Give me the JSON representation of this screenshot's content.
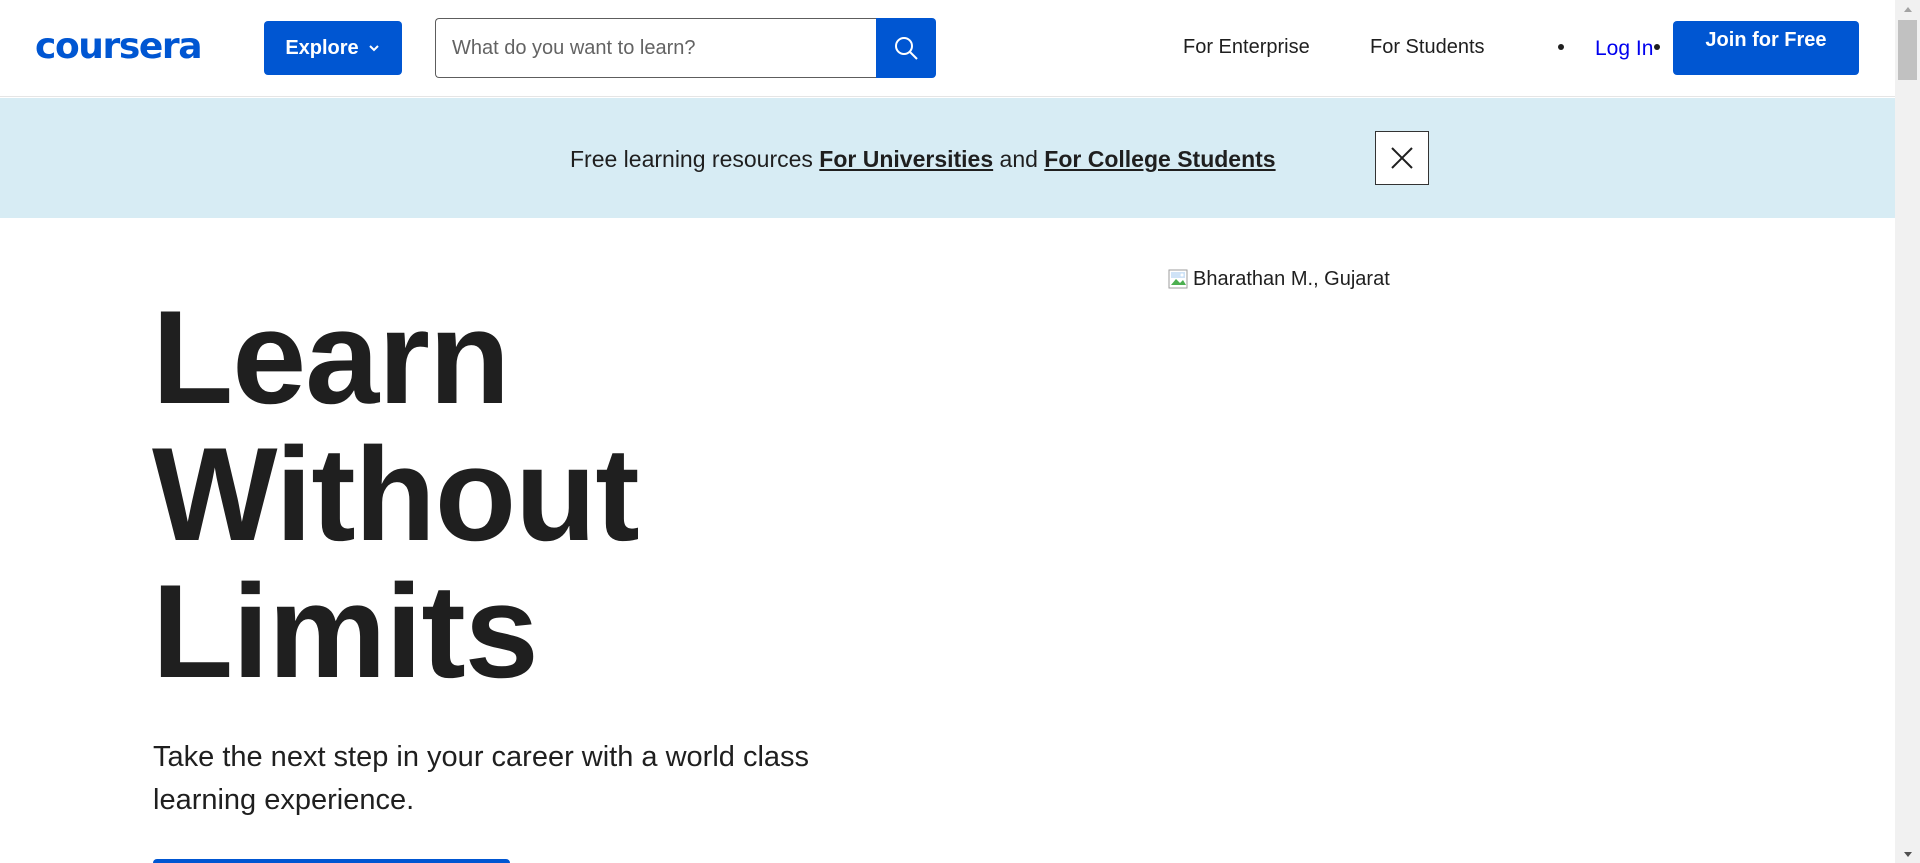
{
  "header": {
    "logo_text": "coursera",
    "explore_label": "Explore",
    "search": {
      "placeholder": "What do you want to learn?"
    },
    "nav": {
      "enterprise": "For Enterprise",
      "students": "For Students",
      "login": "Log In",
      "join": "Join for Free"
    }
  },
  "banner": {
    "prefix": "Free learning resources ",
    "link_universities": "For Universities",
    "conjunction": " and ",
    "link_college": "For College Students"
  },
  "hero": {
    "title_lines": [
      "Learn",
      "Without",
      "Limits"
    ],
    "subtitle": "Take the next step in your career with a world class learning experience.",
    "image_alt": "Bharathan M., Gujarat"
  },
  "colors": {
    "brand_blue": "#0056d2",
    "banner_bg": "#d7ecf4",
    "text": "#1f1f1f",
    "link_blue": "#0000ee"
  },
  "icons": {
    "explore_chevron": "chevron-down-icon",
    "search": "search-icon",
    "close": "close-icon",
    "broken_image": "broken-image-icon"
  }
}
